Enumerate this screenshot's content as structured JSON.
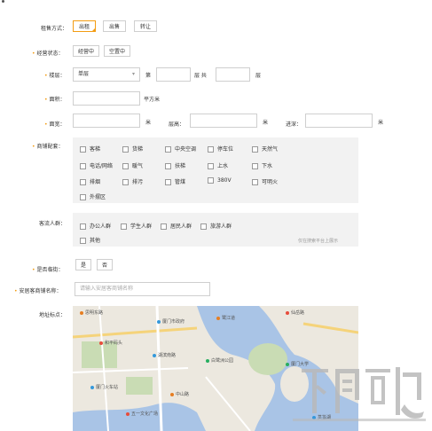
{
  "form": {
    "rent_type": {
      "label": "租售方式：",
      "options": [
        "出租",
        "出售",
        "转让"
      ],
      "selected": "出租"
    },
    "business_status": {
      "label": "经营状态：",
      "options": [
        "经营中",
        "空置中"
      ]
    },
    "floor": {
      "label": "楼层：",
      "select_value": "单层",
      "di": "第",
      "ceng_gong": "层 共",
      "ceng": "层"
    },
    "area": {
      "label": "面积：",
      "unit": "平方米"
    },
    "dimensions": {
      "width_label": "面宽：",
      "width_unit": "米",
      "height_label": "层高：",
      "height_unit": "米",
      "depth_label": "进深：",
      "depth_unit": "米"
    },
    "facilities": {
      "label": "商铺配套：",
      "items": [
        "客梯",
        "货梯",
        "中央空调",
        "停车位",
        "天然气",
        "电话/网络",
        "暖气",
        "扶梯",
        "上水",
        "下水",
        "排烟",
        "排污",
        "管煤",
        "380V",
        "可明火",
        "外摆区"
      ]
    },
    "crowd": {
      "label": "客流人群：",
      "items": [
        "办公人群",
        "学生人群",
        "居民人群",
        "旅游人群",
        "其他"
      ],
      "note": "仅在搜索平台上展示"
    },
    "street": {
      "label": "是否临街：",
      "options": [
        "是",
        "否"
      ]
    },
    "shop_name": {
      "label": "安居客商铺名称：",
      "placeholder": "请输入安居客商铺名称"
    },
    "address": {
      "label": "地址标点："
    }
  },
  "map": {
    "pois": [
      "思明东路",
      "厦门市政府",
      "鹭江道",
      "仙岳路",
      "和平码头",
      "湖滨南路",
      "厦门大学",
      "白鹭洲公园",
      "厦门火车站",
      "中山路",
      "五一文化广场",
      "筼筜湖"
    ]
  },
  "watermark": {
    "text": "下载吧"
  },
  "colors": {
    "accent": "#f39c12",
    "water": "#a9c4e6",
    "green": "#c9dcb4"
  }
}
